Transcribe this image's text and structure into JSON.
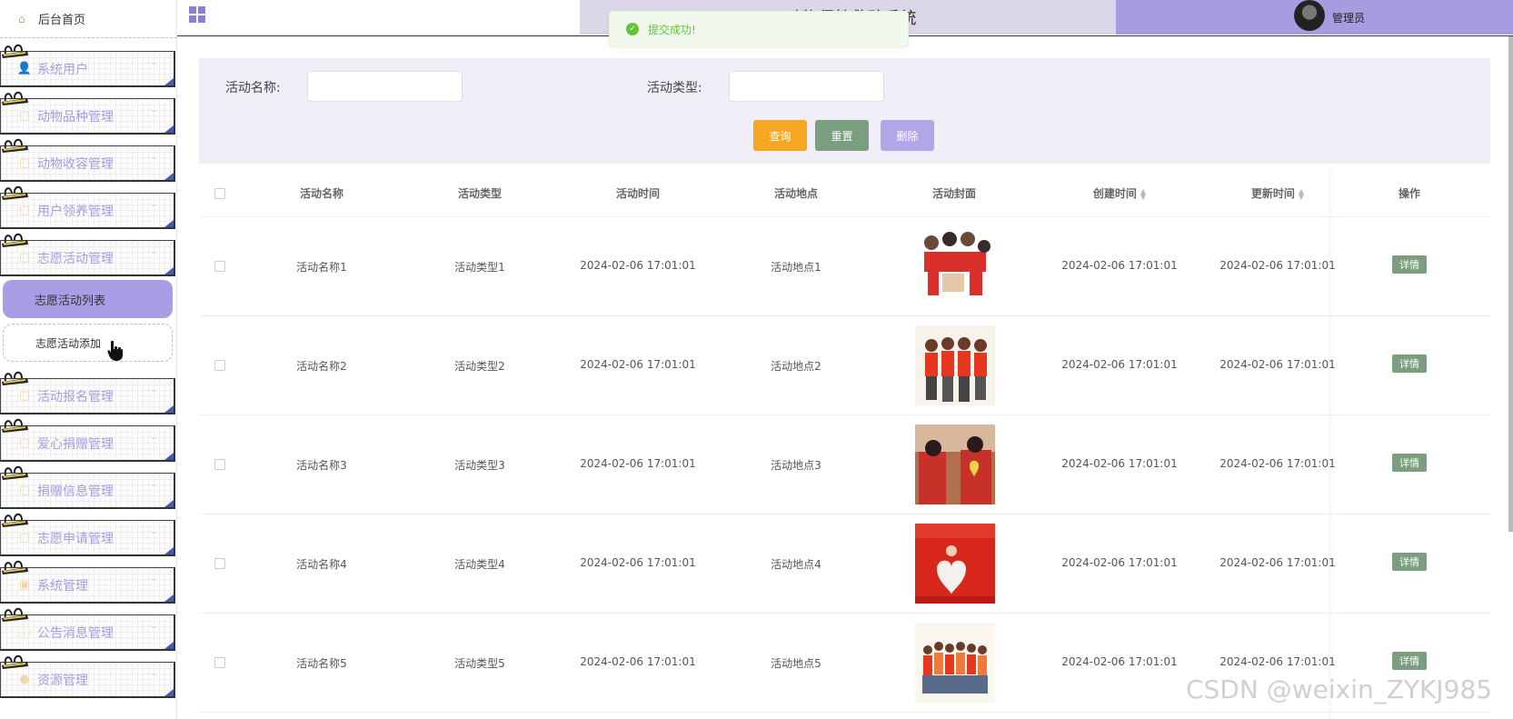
{
  "header": {
    "system_title": "动物保护救助系统",
    "user_label": "管理员"
  },
  "toast": {
    "message": "提交成功!"
  },
  "sidebar": {
    "home_label": "后台首页",
    "items": [
      {
        "label": "系统用户",
        "icon": "user-icon"
      },
      {
        "label": "动物品种管理",
        "icon": "doc-icon"
      },
      {
        "label": "动物收容管理",
        "icon": "doc-icon"
      },
      {
        "label": "用户领养管理",
        "icon": "doc-icon"
      },
      {
        "label": "志愿活动管理",
        "icon": "doc-icon"
      },
      {
        "label": "活动报名管理",
        "icon": "doc-icon"
      },
      {
        "label": "爱心捐赠管理",
        "icon": "doc-icon"
      },
      {
        "label": "捐赠信息管理",
        "icon": "doc-icon"
      },
      {
        "label": "志愿申请管理",
        "icon": "doc-icon"
      },
      {
        "label": "系统管理",
        "icon": "settings-icon"
      },
      {
        "label": "公告消息管理",
        "icon": "info-icon"
      },
      {
        "label": "资源管理",
        "icon": "resource-icon"
      }
    ],
    "submenu": {
      "active_label": "志愿活动列表",
      "other_label": "志愿活动添加"
    }
  },
  "search": {
    "name_label": "活动名称:",
    "type_label": "活动类型:",
    "name_value": "",
    "type_value": "",
    "query_label": "查询",
    "reset_label": "重置",
    "delete_label": "删除"
  },
  "table": {
    "columns": [
      "活动名称",
      "活动类型",
      "活动时间",
      "活动地点",
      "活动封面",
      "创建时间",
      "更新时间",
      "操作"
    ],
    "detail_label": "详情",
    "rows": [
      {
        "name": "活动名称1",
        "type": "活动类型1",
        "time": "2024-02-06 17:01:01",
        "place": "活动地点1",
        "created": "2024-02-06 17:01:01",
        "updated": "2024-02-06 17:01:01"
      },
      {
        "name": "活动名称2",
        "type": "活动类型2",
        "time": "2024-02-06 17:01:01",
        "place": "活动地点2",
        "created": "2024-02-06 17:01:01",
        "updated": "2024-02-06 17:01:01"
      },
      {
        "name": "活动名称3",
        "type": "活动类型3",
        "time": "2024-02-06 17:01:01",
        "place": "活动地点3",
        "created": "2024-02-06 17:01:01",
        "updated": "2024-02-06 17:01:01"
      },
      {
        "name": "活动名称4",
        "type": "活动类型4",
        "time": "2024-02-06 17:01:01",
        "place": "活动地点4",
        "created": "2024-02-06 17:01:01",
        "updated": "2024-02-06 17:01:01"
      },
      {
        "name": "活动名称5",
        "type": "活动类型5",
        "time": "2024-02-06 17:01:01",
        "place": "活动地点5",
        "created": "2024-02-06 17:01:01",
        "updated": "2024-02-06 17:01:01"
      }
    ]
  },
  "watermark": "CSDN @weixin_ZYKJ985",
  "colors": {
    "accent": "#a89be0",
    "query": "#f5a623",
    "reset": "#7a9e7e",
    "delete": "#b3a6e8",
    "detail": "#7a9e7e"
  }
}
